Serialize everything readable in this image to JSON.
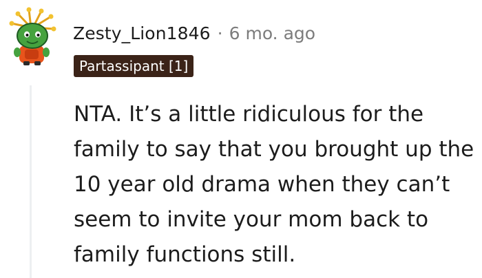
{
  "comment": {
    "author": "Zesty_Lion1846",
    "separator": "·",
    "timestamp": "6 mo. ago",
    "flair": "Partassipant [1]",
    "body": "NTA. It’s a little ridiculous for the family to say that you brought up the 10 year old drama when they can’t seem to invite your mom back to family functions still."
  },
  "colors": {
    "flair_background": "#3b2318",
    "flair_text": "#ffffff",
    "meta_text": "#7c7c7c",
    "thread_line": "#edeff1"
  },
  "icons": {
    "avatar": "snoo-avatar-icon"
  }
}
